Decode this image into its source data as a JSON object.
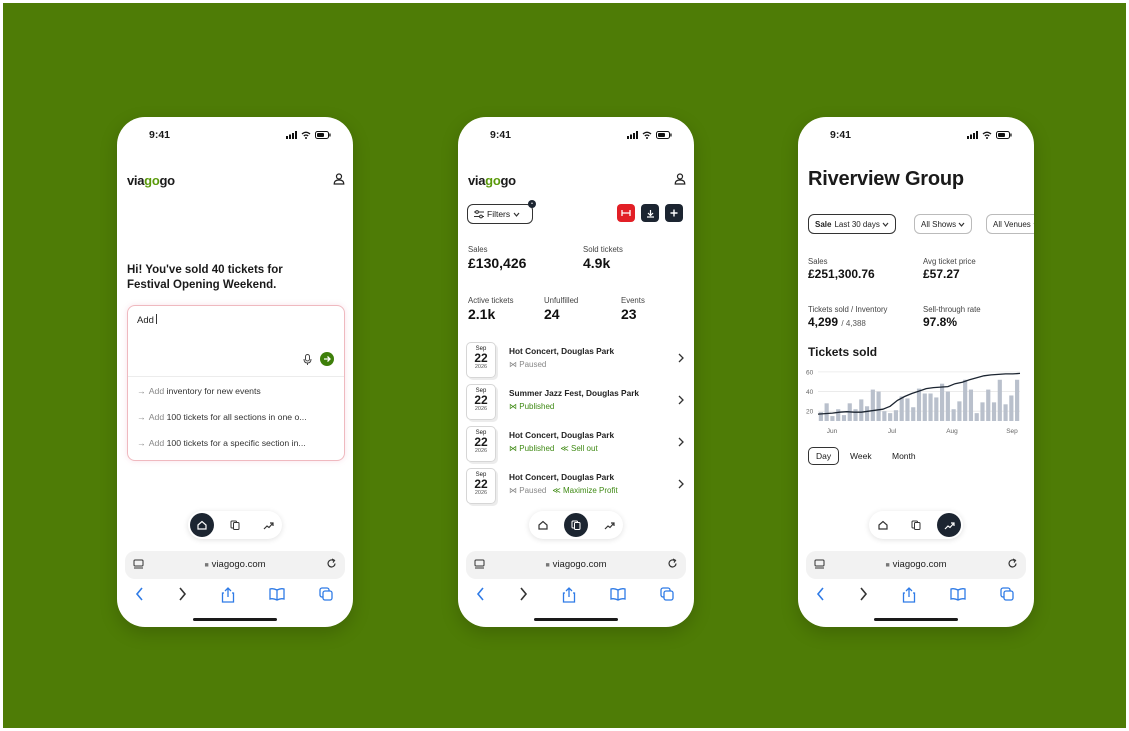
{
  "colors": {
    "background": "#4e7c06",
    "accent_green": "#3f8a14",
    "dark": "#1c2531",
    "red": "#e21f26"
  },
  "status": {
    "time": "9:41"
  },
  "brand": {
    "pre": "via",
    "mid": "go",
    "post": "go"
  },
  "browser": {
    "url": "viagogo.com"
  },
  "phone1": {
    "greeting": "Hi! You've sold 40 tickets for Festival Opening Weekend.",
    "input_value": "Add",
    "suggestions": [
      {
        "lead": "Add",
        "text": "inventory for new events"
      },
      {
        "lead": "Add",
        "text": "100 tickets for all sections in one o..."
      },
      {
        "lead": "Add",
        "text": "100 tickets for a specific section in..."
      }
    ]
  },
  "phone2": {
    "filters_label": "Filters",
    "filters_badge": "•",
    "stats_top": [
      {
        "label": "Sales",
        "value": "£130,426"
      },
      {
        "label": "Sold tickets",
        "value": "4.9k"
      }
    ],
    "stats_mid": [
      {
        "label": "Active tickets",
        "value": "2.1k"
      },
      {
        "label": "Unfulfilled",
        "value": "24"
      },
      {
        "label": "Events",
        "value": "23"
      }
    ],
    "events": [
      {
        "month": "Sep",
        "day": "22",
        "year": "2026",
        "title": "Hot Concert, Douglas Park",
        "status": "Paused",
        "extra": ""
      },
      {
        "month": "Sep",
        "day": "22",
        "year": "2026",
        "title": "Summer Jazz Fest, Douglas Park",
        "status": "Published",
        "extra": ""
      },
      {
        "month": "Sep",
        "day": "22",
        "year": "2026",
        "title": "Hot Concert, Douglas Park",
        "status": "Published",
        "extra": "Sell out"
      },
      {
        "month": "Sep",
        "day": "22",
        "year": "2026",
        "title": "Hot Concert, Douglas Park",
        "status": "Paused",
        "extra": "Maximize Profit"
      }
    ]
  },
  "phone3": {
    "title": "Riverview Group",
    "chips": [
      {
        "bold": "Sale",
        "text": "Last 30 days"
      },
      {
        "bold": "",
        "text": "All Shows"
      },
      {
        "bold": "",
        "text": "All Venues"
      }
    ],
    "stats": [
      {
        "label": "Sales",
        "value": "£251,300.76",
        "sub": ""
      },
      {
        "label": "Avg ticket price",
        "value": "£57.27",
        "sub": ""
      },
      {
        "label": "Tickets sold / Inventory",
        "value": "4,299",
        "sub": "/ 4,388"
      },
      {
        "label": "Sell-through rate",
        "value": "97.8%",
        "sub": ""
      }
    ],
    "chart_title": "Tickets sold",
    "ranges": [
      "Day",
      "Week",
      "Month"
    ],
    "selected_range": "Day"
  },
  "chart_data": {
    "type": "bar",
    "title": "Tickets sold",
    "y_ticks": [
      "60",
      "40",
      "20"
    ],
    "ylim": [
      10,
      65
    ],
    "x_ticks": [
      "Jun",
      "Jul",
      "Aug",
      "Sep"
    ],
    "values": [
      19,
      28,
      15,
      22,
      16,
      28,
      22,
      32,
      25,
      42,
      40,
      20,
      18,
      21,
      35,
      33,
      24,
      43,
      38,
      38,
      34,
      48,
      40,
      22,
      30,
      52,
      42,
      18,
      29,
      42,
      29,
      52,
      27,
      36,
      52
    ],
    "trend": [
      17,
      17.5,
      18,
      19,
      19.5,
      19,
      19,
      20,
      21,
      22,
      25,
      31,
      35,
      38,
      40.5,
      43,
      44,
      44.5,
      45,
      48,
      49.5,
      52,
      54,
      56,
      57,
      57.5,
      58,
      58,
      58.5
    ]
  }
}
